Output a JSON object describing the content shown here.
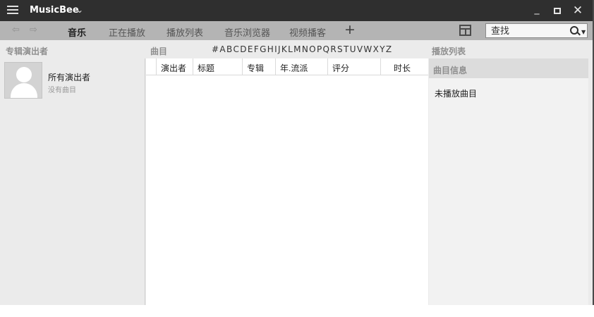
{
  "titlebar": {
    "app_title": "MusicBee",
    "app_menu_chevron": "⌄",
    "menu_icon": "hamburger-icon",
    "controls": {
      "minimize": "_",
      "maximize": "maximize-icon",
      "close": "✕"
    }
  },
  "tabbar": {
    "back_icon": "⇦",
    "forward_icon": "⇨",
    "tabs": [
      {
        "label": "音乐",
        "active": true
      },
      {
        "label": "正在播放",
        "active": false
      },
      {
        "label": "播放列表",
        "active": false
      },
      {
        "label": "音乐浏览器",
        "active": false
      },
      {
        "label": "视频播客",
        "active": false
      }
    ],
    "add_tab": "+",
    "layout_icon": "layout-icon",
    "search_placeholder": "查找"
  },
  "headers": {
    "artists": "专辑演出者",
    "tracks": "曲目",
    "playlist": "播放列表"
  },
  "alphabet": [
    "#",
    "A",
    "B",
    "C",
    "D",
    "E",
    "F",
    "G",
    "H",
    "I",
    "J",
    "K",
    "L",
    "M",
    "N",
    "O",
    "P",
    "Q",
    "R",
    "S",
    "T",
    "U",
    "V",
    "W",
    "X",
    "Y",
    "Z"
  ],
  "artists_panel": {
    "items": [
      {
        "name": "所有演出者",
        "subtitle": "没有曲目",
        "avatar_icon": "person-silhouette-icon"
      }
    ]
  },
  "tracks_panel": {
    "columns": [
      "演出者",
      "标题",
      "专辑",
      "年.流派",
      "评分",
      "时长"
    ],
    "rows": []
  },
  "right_panel": {
    "title": "曲目信息",
    "empty_text": "未播放曲目"
  },
  "colors": {
    "titlebar_bg": "#2f2f2f",
    "tabbar_bg": "#b4b4b4",
    "panel_bg": "#ebebeb",
    "list_bg": "#ffffff"
  }
}
